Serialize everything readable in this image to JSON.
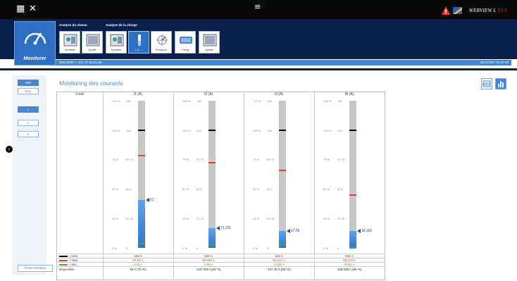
{
  "topbar": {
    "menu_icon": "hamburger-menu-icon",
    "brand_name": "WEBVIEW L",
    "brand_version": "V2.1"
  },
  "ribbon": {
    "monitor_label": "Monitorer",
    "group1_label": "Analyse du réseau",
    "group2_label": "Analyse de la charge",
    "buttons": [
      {
        "label": "Synthèse",
        "icon": "network-synthesis-icon"
      },
      {
        "label": "Qualité",
        "icon": "network-quality-icon"
      },
      {
        "label": "Synthèse",
        "icon": "load-synthesis-icon"
      },
      {
        "label": "I, U, ...",
        "icon": "current-gauge-icon"
      },
      {
        "label": "Puissance",
        "icon": "power-vector-icon"
      },
      {
        "label": "Charge",
        "icon": "load-icon"
      },
      {
        "label": "Qualité",
        "icon": "load-quality-icon"
      }
    ]
  },
  "pathbar": {
    "path": "DECHEIIO > 101 TD ELHLAB",
    "datetime": "15/11/2017 15:47:49"
  },
  "left": {
    "buttons": [
      "Inst",
      "Moy"
    ],
    "selectors": [
      "I",
      "V",
      "U"
    ],
    "reset_label": "Reset Min/Max"
  },
  "main": {
    "title": "Monitoring des courants"
  },
  "table": {
    "first_col_header": "I nod",
    "columns": [
      {
        "header": "I1 (A)",
        "value_label": "51",
        "inom": "125 A",
        "imax": "97.63 A",
        "imin": "4.63 A",
        "dispo": "94 A (75 %)"
      },
      {
        "header": "I2 (A)",
        "value_label": "21,231",
        "inom": "125 A",
        "imax": "90.553 A",
        "imin": "2.98 A",
        "dispo": "103.769 A (83 %)"
      },
      {
        "header": "I3 (A)",
        "value_label": "17,55",
        "inom": "125 A",
        "imax": "82.417 A",
        "imin": "3.649 A",
        "dispo": "107.45 A (86 %)"
      },
      {
        "header": "IN (A)",
        "value_label": "18,162",
        "inom": "125 A",
        "imax": "55.713 A",
        "imin": "0.091 A",
        "dispo": "106.838 A (85 %)"
      }
    ],
    "ticks": [
      {
        "pct": "125 %",
        "val": "156"
      },
      {
        "pct": "100 %",
        "val": "125"
      },
      {
        "pct": "75 %",
        "val": "93,75"
      },
      {
        "pct": "50 %",
        "val": "62,5"
      },
      {
        "pct": "25 %",
        "val": "31,25"
      },
      {
        "pct": "0 %",
        "val": "0"
      }
    ],
    "legend": {
      "inom": "I nom.",
      "imax": "I max.",
      "imin": "I min.",
      "dispo": "Disponible"
    },
    "colors": {
      "inom": "#000000",
      "imax": "#d9432c",
      "imin": "#5aa02c",
      "fill": "#2f74c8"
    }
  },
  "chart_data": {
    "type": "bar",
    "categories": [
      "I1 (A)",
      "I2 (A)",
      "I3 (A)",
      "IN (A)"
    ],
    "values": [
      51,
      21.231,
      17.55,
      18.162
    ],
    "i_nom": [
      125,
      125,
      125,
      125
    ],
    "i_max": [
      97.63,
      90.553,
      82.417,
      55.713
    ],
    "i_min": [
      4.63,
      2.98,
      3.649,
      0.091
    ],
    "ylim": [
      0,
      156
    ],
    "title": "Monitoring des courants"
  }
}
